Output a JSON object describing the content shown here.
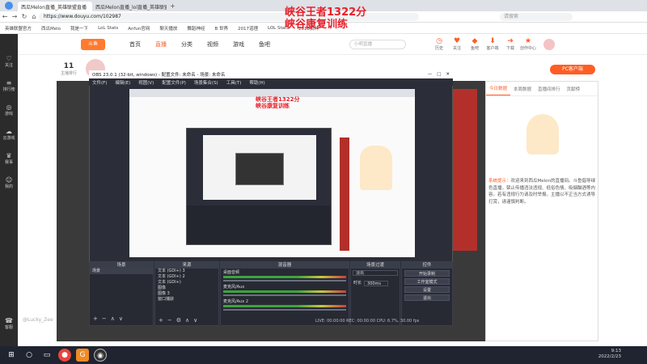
{
  "browser": {
    "tabs": [
      {
        "label": "西瓜Melon直播_英雄联盟直播"
      },
      {
        "label": "西瓜Melon直播_lol直播_英雄联盟"
      }
    ],
    "address": "https://www.douyu.com/102987",
    "search_placeholder": "请搜索",
    "bookmarks": [
      "英雄联盟官方",
      "西瓜Melo",
      "我是一下",
      "LoL Stats",
      "Anfun官网",
      "聊天播放",
      "舞蹈神经",
      "B 世界",
      "2017道理",
      "LOL Stats",
      "2018资料"
    ]
  },
  "site": {
    "logo": "斗鱼",
    "nav": [
      "首页",
      "直播",
      "分类",
      "视频",
      "游戏",
      "鱼吧"
    ],
    "search_placeholder": "小明直播",
    "header_icons": [
      {
        "label": "历史",
        "icon": "clock-icon"
      },
      {
        "label": "关注",
        "icon": "heart-icon"
      },
      {
        "label": "鱼吧",
        "icon": "fish-icon"
      },
      {
        "label": "客户端",
        "icon": "download-icon"
      },
      {
        "label": "下载",
        "icon": "arrow-icon"
      },
      {
        "label": "创作中心",
        "icon": "star-icon"
      }
    ],
    "left_nav": [
      "关注",
      "排行榜",
      "游戏",
      "云游戏",
      "赛事",
      "我的"
    ],
    "left_nav_bottom": "客服",
    "room": {
      "rank_label": "11",
      "rank_sub": "主播排行"
    },
    "pc_client": "PC客户端",
    "chat_tabs": [
      "今日数据",
      "本周数据",
      "直播间排行",
      "贡献榜"
    ],
    "sys_label": "系统提示：",
    "sys_message": "欢迎来到西瓜Melon的直播间。斗鱼倡导绿色直播，禁止传播违法违规、低俗色情、吸烟酗酒等内容。若有违规行为请及时举报。主播以不正当方式诱导打赏，请谨慎判断。"
  },
  "obs": {
    "title": "OBS 23.0.1 (32-bit, windows) - 配置文件: 未命名 - 场景: 未命名",
    "menu": [
      "文件(F)",
      "编辑(E)",
      "视图(V)",
      "配置文件(P)",
      "场景集合(S)",
      "工具(T)",
      "帮助(H)"
    ],
    "docks": {
      "scenes": {
        "title": "场景",
        "items": [
          "场景"
        ]
      },
      "sources": {
        "title": "来源",
        "items": [
          "文本 (GDI+) 3",
          "文本 (GDI+) 2",
          "文本 (GDI+)",
          "图像",
          "图像 3",
          "窗口捕获"
        ]
      },
      "mixer": {
        "title": "混音器",
        "tracks": [
          "桌面音频",
          "麦克风/Aux",
          "麦克风/Aux 2"
        ]
      },
      "transitions": {
        "title": "场景过渡",
        "type": "淡出",
        "duration_label": "时长",
        "duration": "300ms"
      },
      "controls": {
        "title": "控件",
        "buttons": [
          "开始录制",
          "工作室模式",
          "设置",
          "退出"
        ]
      }
    },
    "status": "LIVE: 00:00:00   REC: 00:00:00   CPU: 6.7%, 30.00 fps"
  },
  "overlay": {
    "line1": "峡谷王者1322分",
    "line2": "峡谷康复训练"
  },
  "taskbar": {
    "time": "9:13",
    "date": "2022/2/23"
  },
  "watermark": "@Lucky_Zee"
}
